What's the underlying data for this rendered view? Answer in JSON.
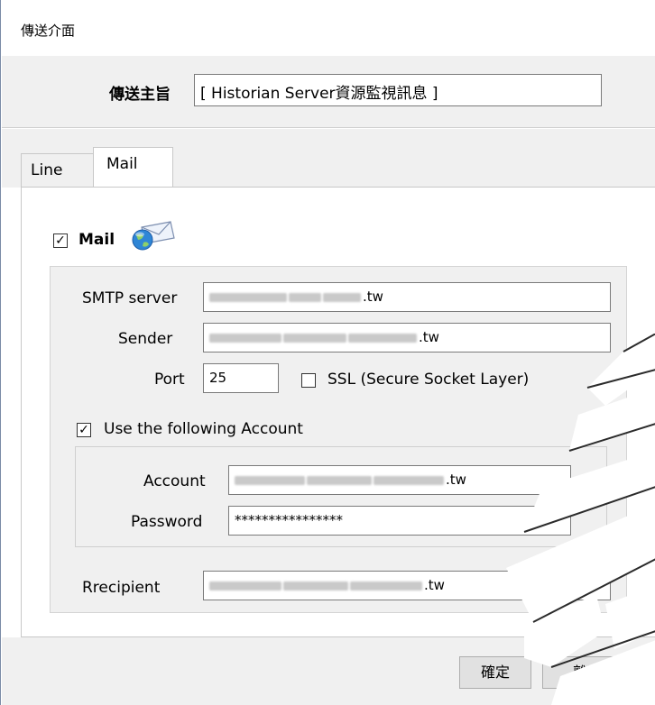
{
  "window": {
    "title": "傳送介面"
  },
  "subject": {
    "label": "傳送主旨",
    "value": "[ Historian Server資源監視訊息 ]"
  },
  "tabs": [
    {
      "label": "Line"
    },
    {
      "label": "Mail"
    }
  ],
  "mail": {
    "enable_label": "Mail",
    "enabled": true,
    "smtp_label": "SMTP server",
    "smtp_suffix": ".tw",
    "sender_label": "Sender",
    "sender_suffix": ".tw",
    "port_label": "Port",
    "port_value": "25",
    "ssl_label": "SSL (Secure Socket Layer)",
    "ssl_checked": false,
    "use_account_label": "Use the following Account",
    "use_account_checked": true,
    "account_label": "Account",
    "account_suffix": ".tw",
    "password_label": "Password",
    "password_value": "****************",
    "recipient_label": "Rrecipient",
    "recipient_suffix": ".tw"
  },
  "buttons": {
    "ok": "確定",
    "exit": "離開"
  },
  "icons": {
    "mail_icon": "mail-globe-icon"
  }
}
